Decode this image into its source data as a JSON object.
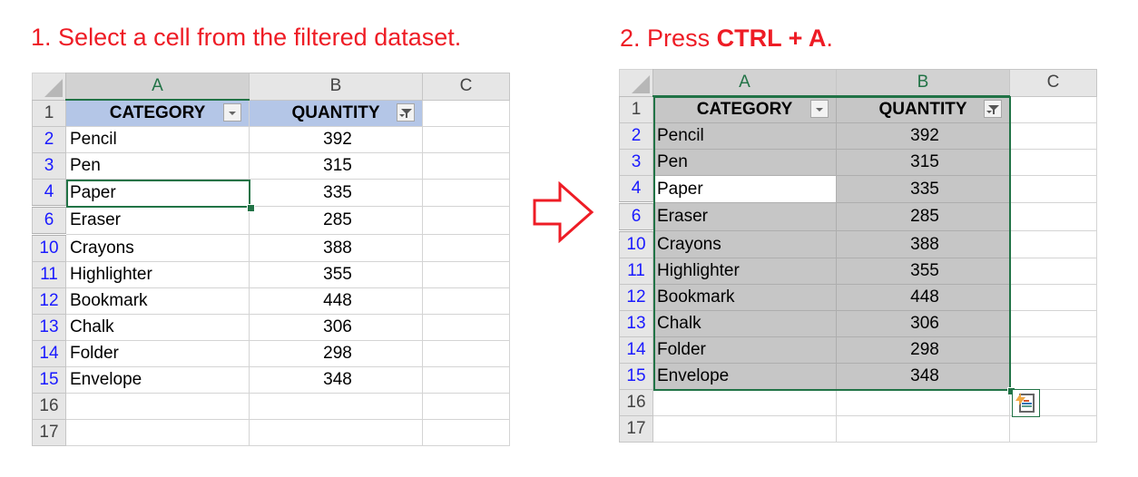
{
  "steps": [
    {
      "number": "1.",
      "text": "Select a cell from the filtered dataset."
    },
    {
      "number": "2.",
      "text_prefix": "Press",
      "text_bold": "CTRL + A",
      "text_suffix": "."
    }
  ],
  "colors": {
    "title": "#ee1c25",
    "arrow": "#ee1c25",
    "selection_border": "#217346",
    "header_fill": "#b4c6e7",
    "header_fill_selected": "#8497b0",
    "selected_range_fill": "#c6c6c6",
    "filtered_row_number": "#1a1aff"
  },
  "columns": [
    "A",
    "B",
    "C"
  ],
  "headers": {
    "category": "CATEGORY",
    "quantity": "QUANTITY"
  },
  "header_row_number": "1",
  "rows": [
    {
      "row": "2",
      "category": "Pencil",
      "quantity": "392"
    },
    {
      "row": "3",
      "category": "Pen",
      "quantity": "315"
    },
    {
      "row": "4",
      "category": "Paper",
      "quantity": "335"
    },
    {
      "row": "6",
      "category": "Eraser",
      "quantity": "285"
    },
    {
      "row": "10",
      "category": "Crayons",
      "quantity": "388"
    },
    {
      "row": "11",
      "category": "Highlighter",
      "quantity": "355"
    },
    {
      "row": "12",
      "category": "Bookmark",
      "quantity": "448"
    },
    {
      "row": "13",
      "category": "Chalk",
      "quantity": "306"
    },
    {
      "row": "14",
      "category": "Folder",
      "quantity": "298"
    },
    {
      "row": "15",
      "category": "Envelope",
      "quantity": "348"
    }
  ],
  "empty_rows": [
    "16",
    "17"
  ],
  "sheet1": {
    "active_cell": "A4",
    "active_cell_value": "Paper"
  },
  "sheet2": {
    "selected_range": "A1:B15",
    "active_cell": "A4"
  },
  "icons": {
    "filter_category": "dropdown-arrow-icon",
    "filter_quantity": "filter-funnel-icon",
    "arrow": "right-arrow-icon",
    "quick_analysis": "quick-analysis-icon"
  }
}
